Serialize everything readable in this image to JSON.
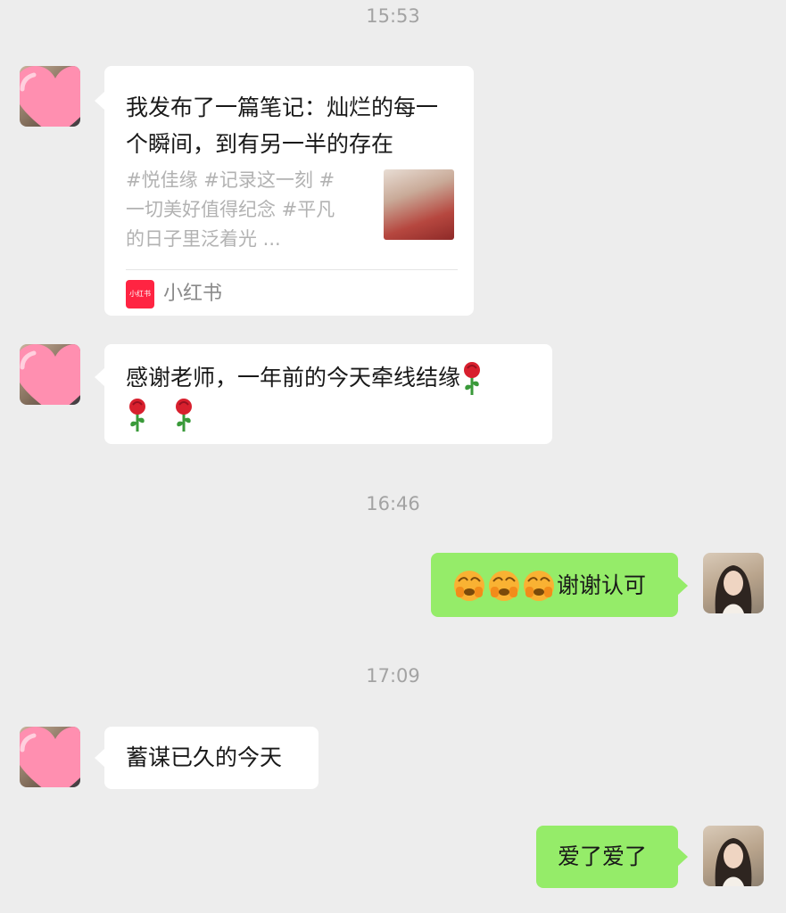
{
  "chat": {
    "timestamps": [
      "15:53",
      "16:46",
      "17:09"
    ],
    "card": {
      "title": "我发布了一篇笔记：灿烂的每一个瞬间，到有另一半的存在",
      "tags": "#悦佳缘  #记录这一刻  #一切美好值得纪念  #平凡的日子里泛着光 ...",
      "source_icon_text": "小红书",
      "source": "小红书"
    },
    "messages": [
      {
        "side": "left",
        "text": "感谢老师，一年前的今天牵线结缘",
        "emoji": "rose-icon x3"
      },
      {
        "side": "right",
        "text": "谢谢认可",
        "emoji": "face-icon x3"
      },
      {
        "side": "left",
        "text": "蓄谋已久的今天"
      },
      {
        "side": "right",
        "text": "爱了爱了"
      }
    ]
  },
  "colors": {
    "background": "#ededed",
    "bubble_incoming": "#ffffff",
    "bubble_outgoing": "#95ec69",
    "timestamp": "#a3a3a3",
    "xiaohongshu_red": "#ff2442",
    "heart_pink": "#ff8fb0"
  }
}
